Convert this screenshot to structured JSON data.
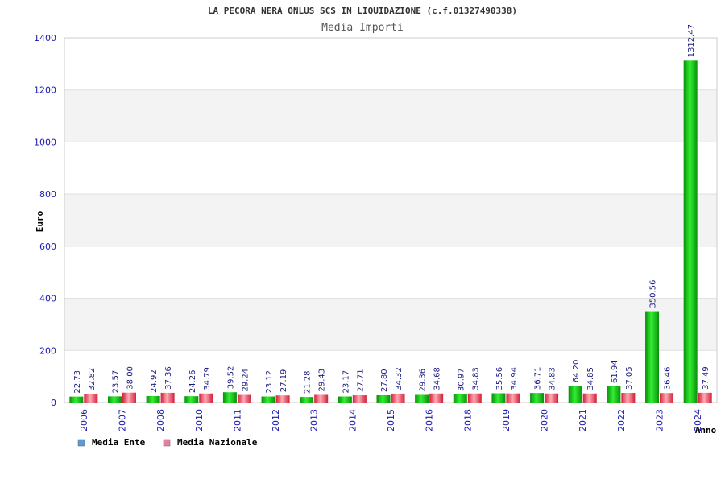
{
  "chart_data": {
    "type": "bar",
    "title": "LA PECORA NERA ONLUS SCS IN LIQUIDAZIONE (c.f.01327490338)",
    "subtitle": "Media Importi",
    "xlabel": "Anno",
    "ylabel": "Euro",
    "ylim": [
      0,
      1400
    ],
    "yticks": [
      0,
      200,
      400,
      600,
      800,
      1000,
      1200,
      1400
    ],
    "grid": true,
    "legend_position": "bottom-left",
    "categories": [
      "2006",
      "2007",
      "2008",
      "2010",
      "2011",
      "2012",
      "2013",
      "2014",
      "2015",
      "2016",
      "2018",
      "2019",
      "2020",
      "2021",
      "2022",
      "2023",
      "2024"
    ],
    "series": [
      {
        "name": "Media Ente",
        "color": "#22bb22",
        "legend_color": "#5b9bd5",
        "values": [
          22.73,
          23.57,
          24.92,
          24.26,
          39.52,
          23.12,
          21.28,
          23.17,
          27.8,
          29.36,
          30.97,
          35.56,
          36.71,
          64.2,
          61.94,
          350.56,
          1312.47
        ],
        "labels": [
          "22.73",
          "23.57",
          "24.92",
          "24.26",
          "39.52",
          "23.12",
          "21.28",
          "23.17",
          "27.80",
          "29.36",
          "30.97",
          "35.56",
          "36.71",
          "64.20",
          "61.94",
          "350.56",
          "1312.47"
        ]
      },
      {
        "name": "Media Nazionale",
        "color": "#e8394a",
        "legend_color": "#e57fa8",
        "values": [
          32.82,
          38.0,
          37.36,
          34.79,
          29.24,
          27.19,
          29.43,
          27.71,
          34.32,
          34.68,
          34.83,
          34.94,
          34.83,
          34.85,
          37.05,
          36.46,
          37.49
        ],
        "labels": [
          "32.82",
          "38.00",
          "37.36",
          "34.79",
          "29.24",
          "27.19",
          "29.43",
          "27.71",
          "34.32",
          "34.68",
          "34.83",
          "34.94",
          "34.83",
          "34.85",
          "37.05",
          "36.46",
          "37.49"
        ]
      }
    ]
  }
}
